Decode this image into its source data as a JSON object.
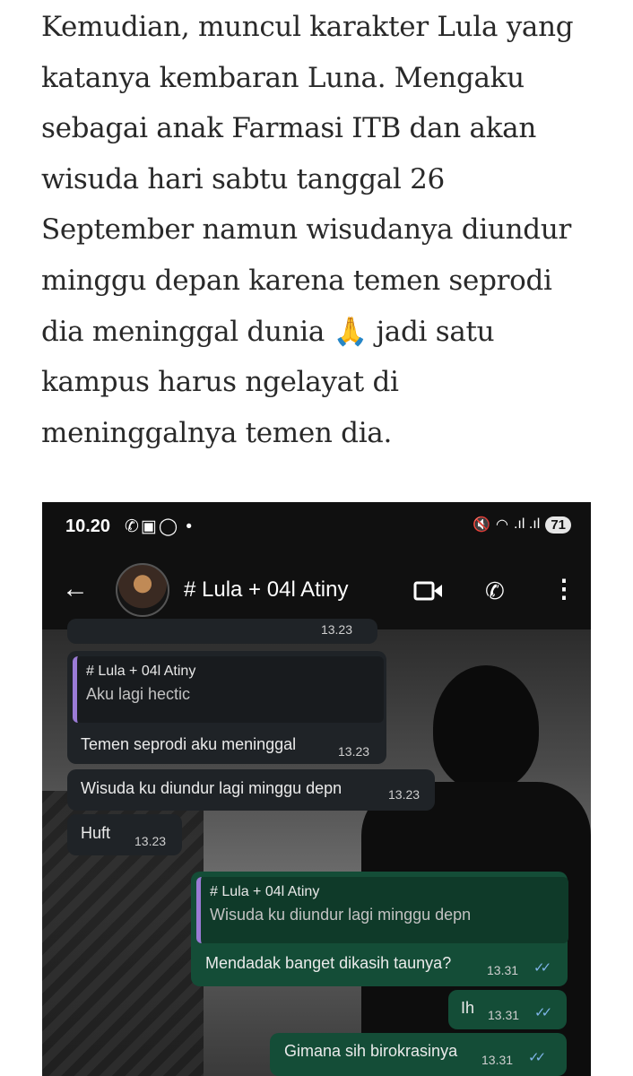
{
  "article": {
    "paragraph": "Kemudian, muncul karakter Lula yang katanya kembaran Luna. Mengaku sebagai anak Farmasi ITB dan akan wisuda hari sabtu tanggal 26 September namun wisudanya diundur minggu depan karena temen seprodi dia meninggal dunia 🙏 jadi satu kampus harus ngelayat di meninggalnya temen dia."
  },
  "status_bar": {
    "time": "10.20",
    "battery": "71"
  },
  "chat": {
    "title": "# Lula + 04l Atiny"
  },
  "messages": {
    "top_partial_time": "13.23",
    "m1_quote_name": "# Lula + 04l Atiny",
    "m1_quote_text": "Aku lagi hectic",
    "m1_text": "Temen seprodi aku meninggal",
    "m1_time": "13.23",
    "m2_text": "Wisuda ku diundur lagi minggu depn",
    "m2_time": "13.23",
    "m3_text": "Huft",
    "m3_time": "13.23",
    "m4_quote_name": "# Lula + 04l Atiny",
    "m4_quote_text": "Wisuda ku diundur lagi minggu depn",
    "m4_text": "Mendadak banget dikasih taunya?",
    "m4_time": "13.31",
    "m5_text": "Ih",
    "m5_time": "13.31",
    "m6_text": "Gimana sih birokrasinya",
    "m6_time": "13.31"
  },
  "colors": {
    "incoming_bubble": "#1f2327",
    "outgoing_bubble": "#144d37",
    "quote_bar": "#9b7bd6",
    "read_ticks": "#7fb4e8"
  },
  "icons": [
    "whatsapp-icon",
    "screenshot-icon",
    "chat-icon",
    "mute-icon",
    "wifi-icon",
    "signal-icon",
    "back-arrow-icon",
    "video-call-icon",
    "phone-icon",
    "more-icon",
    "double-check-icon"
  ]
}
